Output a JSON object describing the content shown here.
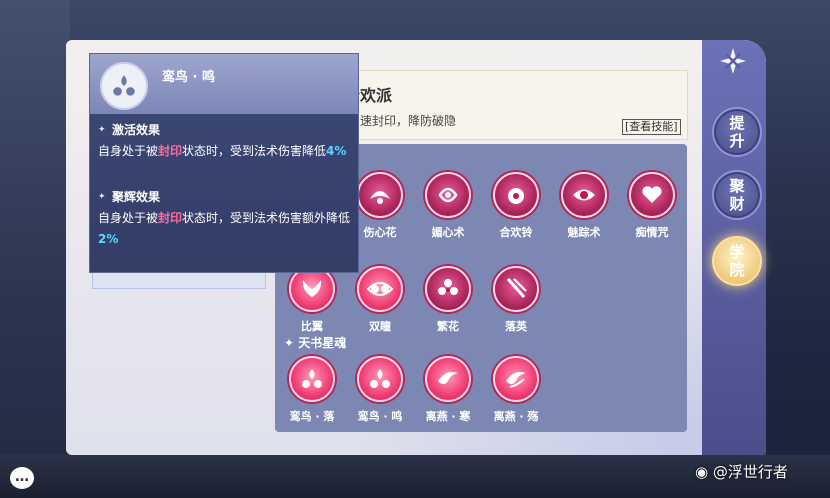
{
  "panel": {
    "close_icon": "close-x-icon",
    "side_buttons": [
      {
        "label": "提升"
      },
      {
        "label": "聚财"
      },
      {
        "label": "学院",
        "active": true
      }
    ]
  },
  "school": {
    "name": "合欢派",
    "description": "速封印，降防破隐",
    "view_skills": "[查看技能]"
  },
  "tooltip": {
    "title": "鸾鸟 · 鸣",
    "activation_title": "激活效果",
    "activation_parts": [
      "自身处于被",
      "封印",
      "状态时，受到法术伤害降低",
      "4%"
    ],
    "glory_title": "聚辉效果",
    "glory_parts": [
      "自身处于被",
      "封印",
      "状态时，受到法术伤害额外降低",
      "2%"
    ]
  },
  "skills_row1": [
    "伤心花",
    "媚心术",
    "合欢铃",
    "魅踪术",
    "痴情咒"
  ],
  "skills_row2": [
    "比翼",
    "双瞳",
    "繁花",
    "落英"
  ],
  "section2_title": "天书星魂",
  "skills_row3": [
    "鸾鸟 · 落",
    "鸾鸟 · 鸣",
    "离燕 · 寒",
    "离燕 · 殇"
  ],
  "chat_icon": "chat-bubble-icon",
  "watermark": "@浮世行者",
  "colors": {
    "accent_cyan": "#59d7ff",
    "accent_pink": "#ff6aa1",
    "skill_pink": "#f03d75"
  }
}
